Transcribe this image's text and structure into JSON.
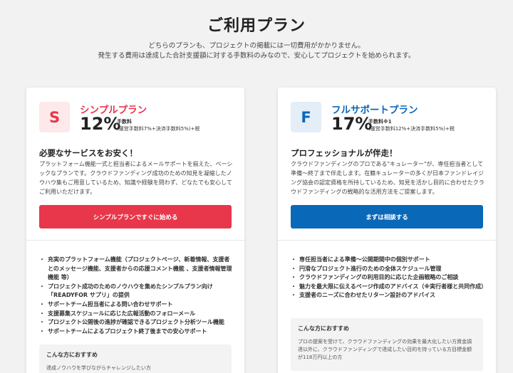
{
  "page": {
    "title": "ご利用プラン",
    "intro_line1": "どちらのプランも、プロジェクトの掲載には一切費用がかかりません。",
    "intro_line2": "発生する費用は達成した合計支援額に対する手数料のみなので、安心してプロジェクトを始められます。"
  },
  "plans": {
    "simple": {
      "badge": "S",
      "name": "シンプルプラン",
      "rate": "12%",
      "fee_label": "手数料",
      "fee_detail": "(運営手数料7%+決済手数料5%)+税",
      "heading": "必要なサービスをお安く！",
      "description": "プラットフォーム機能一式と担当者によるメールサポートを揃えた、ベーシックなプランです。クラウドファンディング成功のための知見を凝縮したノウハウ集もご用意しているため、知識や経験を問わず、どなたでも安心してご利用いただけます。",
      "cta": "シンプルプランですぐに始める",
      "features": [
        "充実のプラットフォーム機能（プロジェクトページ、新着情報、支援者とのメッセージ機能、支援者からの応援コメント機能 、支援者情報管理機能 等）",
        "プロジェクト成功のためのノウハウを集めたシンプルプラン向け「READYFOR サプリ」の提供",
        "サポートチーム担当者による問い合わせサポート",
        "支援募集スケジュールに応じた広報活動のフォローメール",
        "プロジェクト公開後の進捗が確認できるプロジェクト分析ツール機能",
        "サポートチームによるプロジェクト終了後までの安心サポート"
      ],
      "reco_title": "こんな方におすすめ",
      "reco_text": "達成ノウハウを学びながらチャレンジしたい方"
    },
    "full": {
      "badge": "F",
      "name": "フルサポートプラン",
      "rate": "17%",
      "fee_label": "手数料※1",
      "fee_detail": "(運営手数料12%+決済手数料5%)+税",
      "heading": "プロフェッショナルが伴走！",
      "description": "クラウドファンディングのプロである\"キュレーター\"が、専任担当者として準備〜終了まで伴走します。在籍キュレーターの多くが日本ファンドレイジング協会の認定資格を所持しているため、知見を活かし目的に合わせたクラウドファンディングの戦略的な活用方法をご提案します。",
      "cta": "まずは相談する",
      "features": [
        "専任担当者による準備〜公開期間中の個別サポート",
        "円滑なプロジェクト進行のための全体スケジュール管理",
        "クラウドファンディングの利用目的に応じた企画戦略のご相談",
        "魅力を最大限に伝えるページ作成のアドバイス（※実行者様と共同作成）",
        "支援者のニーズに合わせたリターン設計のアドバイス"
      ],
      "reco_title": "こんな方におすすめ",
      "reco_text": "プロの提案を受けて、クラウドファンディングの効果を最大化したい方資金調達以外に、クラウドファンディングで達成したい目的を持っている方目標金額が118万円以上の方"
    }
  },
  "colors": {
    "simple_accent": "#e8364a",
    "full_accent": "#0a68b8"
  }
}
